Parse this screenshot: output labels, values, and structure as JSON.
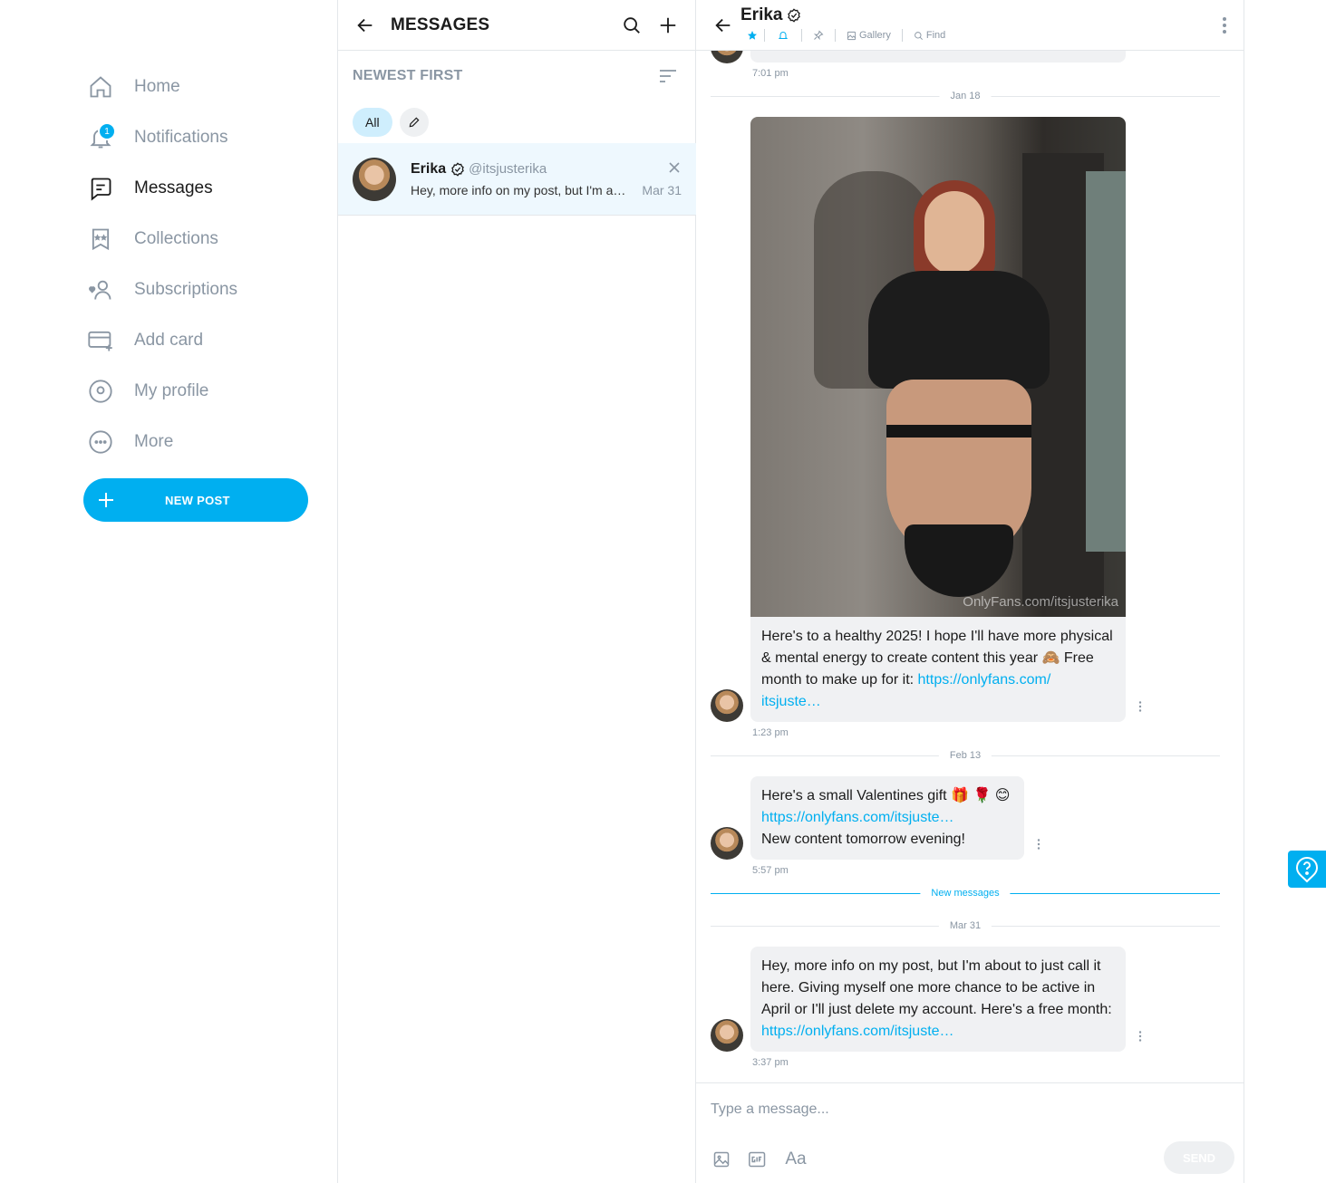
{
  "nav": {
    "home": "Home",
    "notifications": "Notifications",
    "notifications_badge": "1",
    "messages": "Messages",
    "collections": "Collections",
    "subscriptions": "Subscriptions",
    "add_card": "Add card",
    "my_profile": "My profile",
    "more": "More",
    "new_post": "NEW POST"
  },
  "messages_list": {
    "title": "MESSAGES",
    "sort_label": "NEWEST FIRST",
    "filter_all": "All",
    "conversations": [
      {
        "name": "Erika",
        "handle": "@itsjusterika",
        "preview": "Hey, more info on my post, but I'm about to just call it here.",
        "date": "Mar 31"
      }
    ]
  },
  "chat": {
    "name": "Erika",
    "tools": {
      "gallery": "Gallery",
      "find": "Find"
    },
    "messages": [
      {
        "time": "7:01 pm"
      },
      {
        "date": "Jan 18",
        "watermark": "OnlyFans.com/itsjusterika",
        "text": "Here's to a healthy 2025! I hope I'll have more physical & mental energy to create content this year 🙈 Free month to make up for it: ",
        "link1": "https://onlyfans.com/",
        "link2": "itsjuste…",
        "time": "1:23 pm"
      },
      {
        "date": "Feb 13",
        "line1": "Here's a small Valentines gift 🎁 🌹 😊",
        "link": "https://onlyfans.com/itsjuste…",
        "line2": "New content tomorrow evening!",
        "time": "5:57 pm"
      },
      {
        "new_messages_label": "New messages"
      },
      {
        "date": "Mar 31",
        "text": "Hey, more info on my post, but I'm about to just call it here. Giving myself one more chance to be active in April or I'll just delete my account. Here's a free month:",
        "link": "https://onlyfans.com/itsjuste…",
        "time": "3:37 pm"
      }
    ],
    "composer": {
      "placeholder": "Type a message...",
      "text_icon_label": "Aa",
      "send": "SEND"
    }
  },
  "colors": {
    "accent": "#00aff0",
    "muted": "#8a96a3",
    "bubble": "#f0f1f3"
  }
}
